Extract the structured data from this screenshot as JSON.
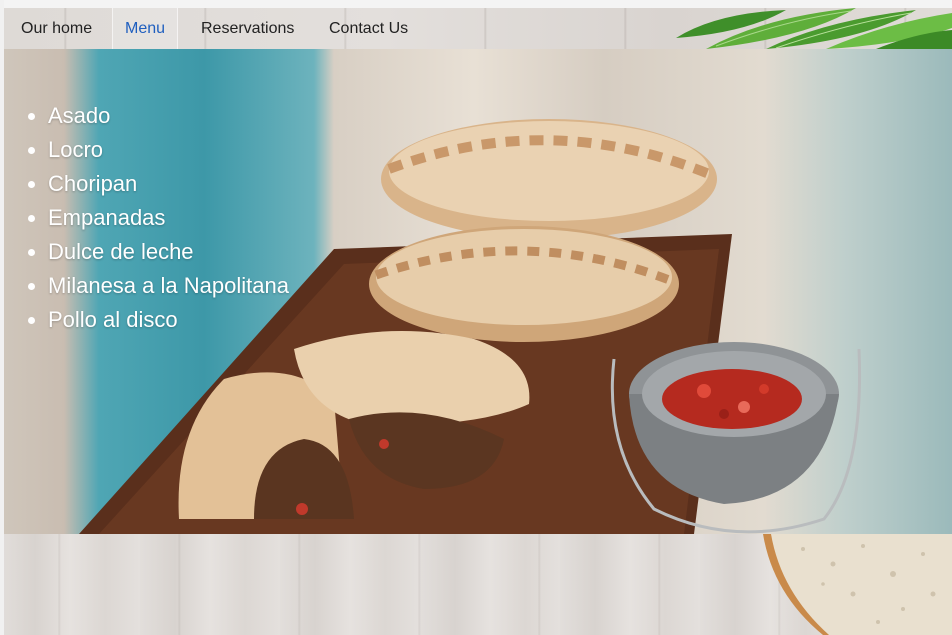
{
  "nav": {
    "items": [
      {
        "label": "Our home"
      },
      {
        "label": "Menu"
      },
      {
        "label": "Reservations"
      },
      {
        "label": "Contact Us"
      }
    ],
    "active_index": 1,
    "active_color": "#1f5fbf"
  },
  "menu": {
    "dishes": [
      "Asado",
      "Locro",
      "Choripan",
      "Empanadas",
      "Dulce de leche",
      "Milanesa a la Napolitana",
      "Pollo al disco"
    ]
  }
}
